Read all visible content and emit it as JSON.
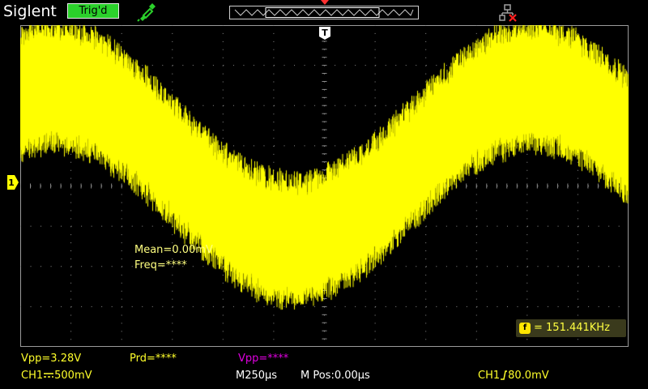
{
  "header": {
    "brand": "Siglent",
    "trigger_status": "Trig'd"
  },
  "display": {
    "trigger_marker": "T",
    "ch1_marker": "1",
    "trace_color": "#ffff00",
    "grid_color": "#8a8a8a"
  },
  "measurements": {
    "mean": "Mean=0.00mV",
    "freq": "Freq=****"
  },
  "freq_counter": {
    "icon": "f",
    "value": "= 151.441KHz"
  },
  "status": {
    "vpp1": "Vpp=3.28V",
    "prd": "Prd=****",
    "vpp2": "Vpp=****",
    "ch1_prefix": "CH1",
    "ch1_scale": "500mV",
    "m_prefix": "M",
    "m_timebase": "250µs",
    "mpos": "M Pos:0.00µs",
    "trig_prefix": "CH1",
    "trig_level": "80.0mV"
  },
  "icons": {
    "probe": "probe-icon",
    "usb": "usb-disconnected-icon"
  }
}
